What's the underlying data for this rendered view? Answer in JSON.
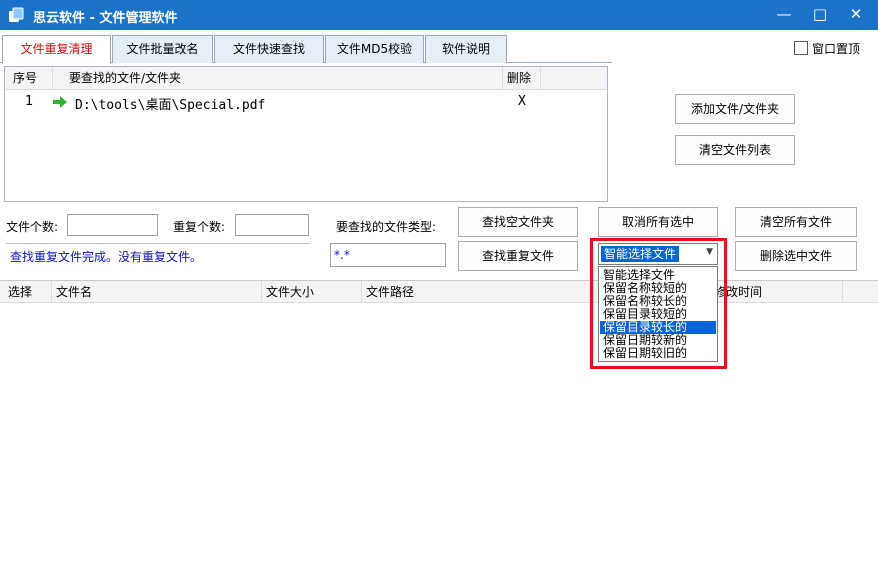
{
  "window": {
    "title": "思云软件 - 文件管理软件",
    "controls": {
      "minimize": "—",
      "maximize": "□",
      "close": "✕"
    }
  },
  "tabs": [
    {
      "label": "文件重复清理",
      "active": true
    },
    {
      "label": "文件批量改名",
      "active": false
    },
    {
      "label": "文件快速查找",
      "active": false
    },
    {
      "label": "文件MD5校验",
      "active": false
    },
    {
      "label": "软件说明",
      "active": false
    }
  ],
  "always_on_top": {
    "label": "窗口置顶",
    "checked": false
  },
  "file_list": {
    "headers": {
      "index": "序号",
      "path": "要查找的文件/文件夹",
      "delete": "删除"
    },
    "rows": [
      {
        "index": "1",
        "path": "D:\\tools\\桌面\\Special.pdf",
        "delete": "X"
      }
    ]
  },
  "buttons": {
    "add": "添加文件/文件夹",
    "clear_list": "清空文件列表",
    "find_empty": "查找空文件夹",
    "cancel_all": "取消所有选中",
    "clear_all": "清空所有文件",
    "find_dup": "查找重复文件",
    "delete_selected": "删除选中文件"
  },
  "stats": {
    "file_count_label": "文件个数:",
    "file_count_value": "",
    "dup_count_label": "重复个数:",
    "dup_count_value": "",
    "type_label": "要查找的文件类型:",
    "type_value": "*.*",
    "status": "查找重复文件完成。没有重复文件。"
  },
  "smart_select": {
    "selected": "智能选择文件",
    "options": [
      "智能选择文件",
      "保留名称较短的",
      "保留名称较长的",
      "保留目录较短的",
      "保留目录较长的",
      "保留日期较新的",
      "保留日期较旧的"
    ],
    "highlighted_index": 4
  },
  "result_table": {
    "headers": {
      "select": "选择",
      "name": "文件名",
      "size": "文件大小",
      "path": "文件路径",
      "mtime": "修改时间"
    }
  },
  "colors": {
    "titlebar": "#1a73c9",
    "active_tab_text": "#d01010",
    "status_text": "#1010c8",
    "highlight": "#0a64d6",
    "annotation_frame": "#e0141e",
    "arrow": "#2db52d"
  }
}
